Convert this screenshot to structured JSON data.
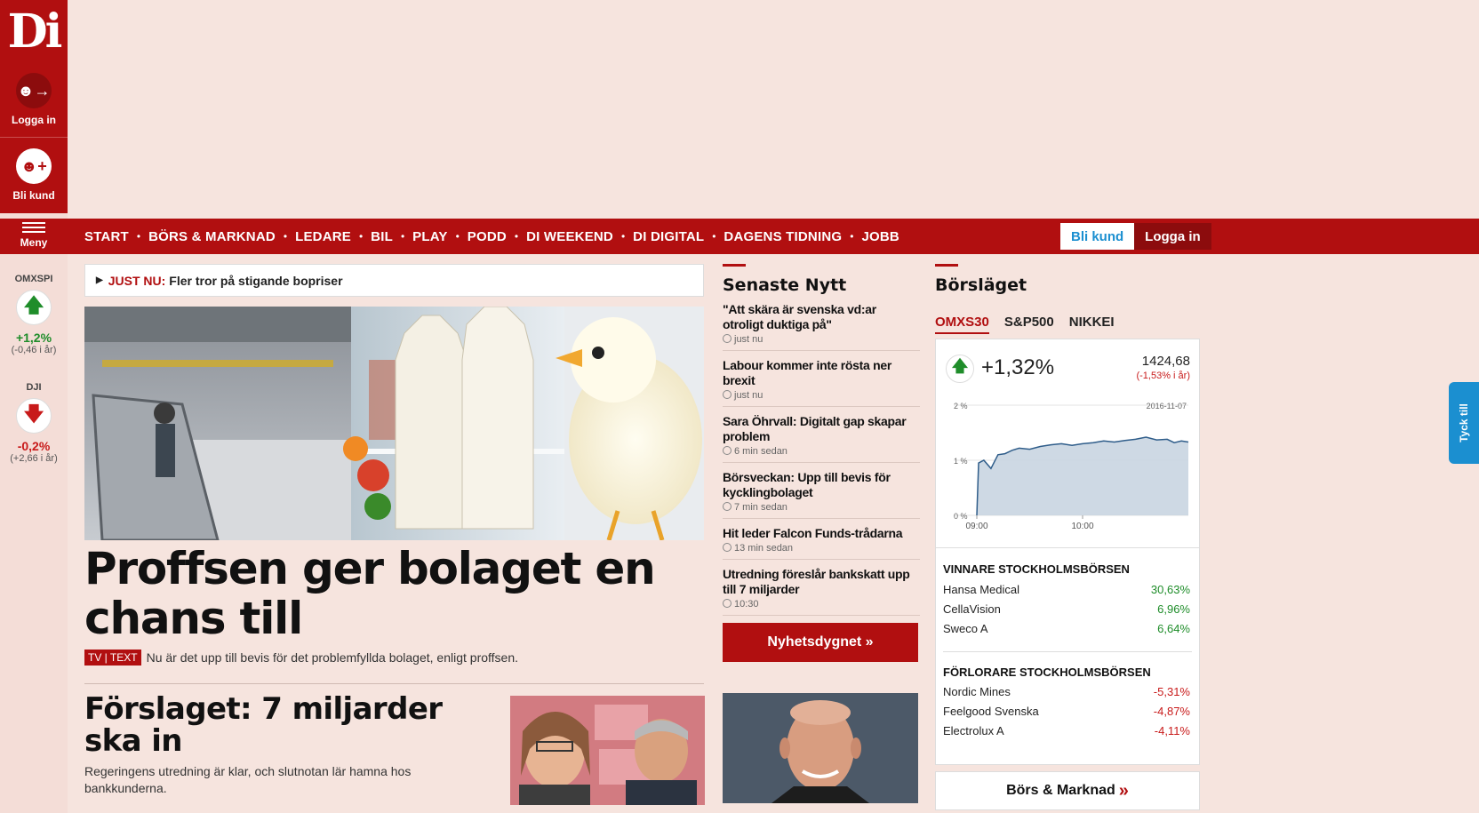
{
  "brand": {
    "logo": "Di",
    "color": "#b10f10"
  },
  "sidebar": {
    "login_label": "Logga in",
    "join_label": "Bli kund",
    "menu_label": "Meny",
    "indices": [
      {
        "name": "OMXSPI",
        "direction": "up",
        "change": "+1,2%",
        "year": "(-0,46 i år)"
      },
      {
        "name": "DJI",
        "direction": "down",
        "change": "-0,2%",
        "year": "(+2,66 i år)"
      }
    ]
  },
  "nav": {
    "items": [
      "START",
      "BÖRS & MARKNAD",
      "LEDARE",
      "BIL",
      "PLAY",
      "PODD",
      "DI WEEKEND",
      "DI DIGITAL",
      "DAGENS TIDNING",
      "JOBB"
    ],
    "separator": "•",
    "join_button": "Bli kund",
    "login_button": "Logga in"
  },
  "just_now": {
    "label": "JUST NU:",
    "text": "Fler tror på stigande bopriser"
  },
  "hero": {
    "title": "Proffsen ger bolaget en chans till",
    "badge": "TV | TEXT",
    "lead": "Nu är det upp till bevis för det problemfyllda bolaget, enligt proffsen."
  },
  "second_article": {
    "title": "Förslaget: 7 miljarder ska in",
    "lead": "Regeringens utredning är klar, och slutnotan lär hamna hos bankkunderna."
  },
  "latest_news": {
    "title": "Senaste Nytt",
    "items": [
      {
        "headline": "\"Att skära är svenska vd:ar otroligt duktiga på\"",
        "time": "just nu"
      },
      {
        "headline": "Labour kommer inte rösta ner brexit",
        "time": "just nu"
      },
      {
        "headline": "Sara Öhrvall: Digitalt gap skapar problem",
        "time": "6 min sedan"
      },
      {
        "headline": "Börsveckan: Upp till bevis för kycklingbolaget",
        "time": "7 min sedan"
      },
      {
        "headline": "Hit leder Falcon Funds-trådarna",
        "time": "13 min sedan"
      },
      {
        "headline": "Utredning föreslår bankskatt upp till 7 miljarder",
        "time": "10:30"
      }
    ],
    "button": "Nyhetsdygnet »"
  },
  "market": {
    "title": "Börsläget",
    "tabs": [
      "OMXS30",
      "S&P500",
      "NIKKEI"
    ],
    "active_tab": "OMXS30",
    "change": "+1,32%",
    "value": "1424,68",
    "year_change": "(-1,53% i år)",
    "winners_title": "VINNARE STOCKHOLMSBÖRSEN",
    "winners": [
      {
        "name": "Hansa Medical",
        "change": "30,63%"
      },
      {
        "name": "CellaVision",
        "change": "6,96%"
      },
      {
        "name": "Sweco A",
        "change": "6,64%"
      }
    ],
    "losers_title": "FÖRLORARE STOCKHOLMSBÖRSEN",
    "losers": [
      {
        "name": "Nordic Mines",
        "change": "-5,31%"
      },
      {
        "name": "Feelgood Svenska",
        "change": "-4,87%"
      },
      {
        "name": "Electrolux A",
        "change": "-4,11%"
      }
    ],
    "button": "Börs & Marknad",
    "button_arrow": "»"
  },
  "feedback_tab": "Tyck till",
  "chart_data": {
    "type": "area",
    "title": "",
    "date_label": "2016-11-07",
    "x_ticks": [
      "09:00",
      "10:00"
    ],
    "y_ticks": [
      "2 %",
      "1 %",
      "0 %"
    ],
    "ylim": [
      0,
      2
    ],
    "x_minutes_from_0900": [
      0,
      1,
      4,
      8,
      12,
      16,
      20,
      24,
      30,
      36,
      42,
      48,
      54,
      60,
      66,
      72,
      78,
      84,
      90,
      96,
      102,
      108,
      112,
      116,
      120
    ],
    "values": [
      0.0,
      0.95,
      1.0,
      0.85,
      1.1,
      1.12,
      1.18,
      1.22,
      1.2,
      1.25,
      1.28,
      1.3,
      1.27,
      1.3,
      1.32,
      1.35,
      1.33,
      1.36,
      1.38,
      1.42,
      1.37,
      1.38,
      1.32,
      1.35,
      1.33
    ],
    "grid": true
  }
}
